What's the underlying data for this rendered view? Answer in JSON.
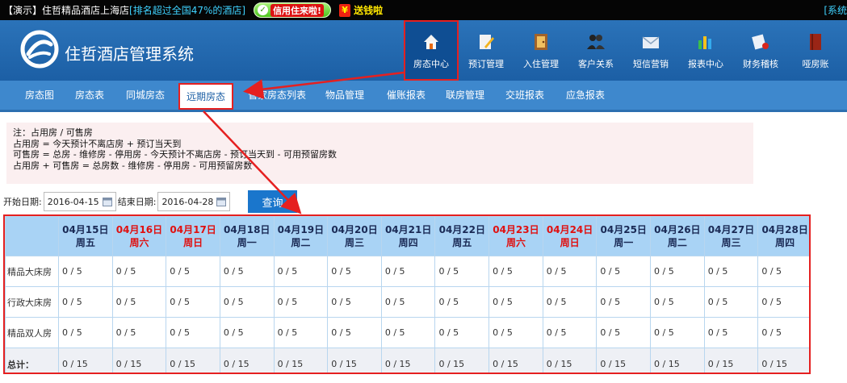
{
  "topbar": {
    "demo_text": "【演示】住哲精品酒店上海店",
    "rank_text": "[排名超过全国47%的酒店]",
    "credit_label": "信用住来啦!",
    "money_label": "送钱啦",
    "system_right": "[系统"
  },
  "header": {
    "brand": "住哲酒店管理系统",
    "nav": [
      {
        "label": "房态中心",
        "icon": "house-icon"
      },
      {
        "label": "预订管理",
        "icon": "pencil-doc-icon"
      },
      {
        "label": "入住管理",
        "icon": "door-icon"
      },
      {
        "label": "客户关系",
        "icon": "people-icon"
      },
      {
        "label": "短信营销",
        "icon": "envelope-icon"
      },
      {
        "label": "报表中心",
        "icon": "bar-chart-icon"
      },
      {
        "label": "财务稽核",
        "icon": "audit-icon"
      },
      {
        "label": "哑房账",
        "icon": "book-icon"
      }
    ]
  },
  "subnav": [
    "房态图",
    "房态表",
    "同城房态",
    "远期房态",
    "管家房态列表",
    "物品管理",
    "催账报表",
    "联房管理",
    "交班报表",
    "应急报表"
  ],
  "note": {
    "lines": [
      "注：占用房 / 可售房",
      "占用房 = 今天预计不离店房 + 预订当天到",
      "可售房 = 总房 - 维修房 - 停用房 - 今天预计不离店房 - 预订当天到 - 可用预留房数",
      "占用房 + 可售房 = 总房数 - 维修房 - 停用房 - 可用预留房数"
    ]
  },
  "query": {
    "start_label": "开始日期:",
    "start_value": "2016-04-15",
    "end_label": "结束日期:",
    "end_value": "2016-04-28",
    "button": "查询"
  },
  "colors": {
    "accent_red": "#e52020",
    "header_blue": "#1c5fa5",
    "subnav_blue": "#3e88cd",
    "table_header": "#a9d3f5",
    "weekend_red": "#e01010"
  },
  "table": {
    "columns": [
      {
        "date": "04月15日",
        "weekday": "周五",
        "weekend": false
      },
      {
        "date": "04月16日",
        "weekday": "周六",
        "weekend": true
      },
      {
        "date": "04月17日",
        "weekday": "周日",
        "weekend": true
      },
      {
        "date": "04月18日",
        "weekday": "周一",
        "weekend": false
      },
      {
        "date": "04月19日",
        "weekday": "周二",
        "weekend": false
      },
      {
        "date": "04月20日",
        "weekday": "周三",
        "weekend": false
      },
      {
        "date": "04月21日",
        "weekday": "周四",
        "weekend": false
      },
      {
        "date": "04月22日",
        "weekday": "周五",
        "weekend": false
      },
      {
        "date": "04月23日",
        "weekday": "周六",
        "weekend": true
      },
      {
        "date": "04月24日",
        "weekday": "周日",
        "weekend": true
      },
      {
        "date": "04月25日",
        "weekday": "周一",
        "weekend": false
      },
      {
        "date": "04月26日",
        "weekday": "周二",
        "weekend": false
      },
      {
        "date": "04月27日",
        "weekday": "周三",
        "weekend": false
      },
      {
        "date": "04月28日",
        "weekday": "周四",
        "weekend": false
      }
    ],
    "rows": [
      {
        "label": "精品大床房",
        "cells": [
          "0 / 5",
          "0 / 5",
          "0 / 5",
          "0 / 5",
          "0 / 5",
          "0 / 5",
          "0 / 5",
          "0 / 5",
          "0 / 5",
          "0 / 5",
          "0 / 5",
          "0 / 5",
          "0 / 5",
          "0 / 5"
        ]
      },
      {
        "label": "行政大床房",
        "cells": [
          "0 / 5",
          "0 / 5",
          "0 / 5",
          "0 / 5",
          "0 / 5",
          "0 / 5",
          "0 / 5",
          "0 / 5",
          "0 / 5",
          "0 / 5",
          "0 / 5",
          "0 / 5",
          "0 / 5",
          "0 / 5"
        ]
      },
      {
        "label": "精品双人房",
        "cells": [
          "0 / 5",
          "0 / 5",
          "0 / 5",
          "0 / 5",
          "0 / 5",
          "0 / 5",
          "0 / 5",
          "0 / 5",
          "0 / 5",
          "0 / 5",
          "0 / 5",
          "0 / 5",
          "0 / 5",
          "0 / 5"
        ]
      }
    ],
    "total": {
      "label": "总计：",
      "cells": [
        "0 / 15",
        "0 / 15",
        "0 / 15",
        "0 / 15",
        "0 / 15",
        "0 / 15",
        "0 / 15",
        "0 / 15",
        "0 / 15",
        "0 / 15",
        "0 / 15",
        "0 / 15",
        "0 / 15",
        "0 / 15"
      ]
    }
  }
}
